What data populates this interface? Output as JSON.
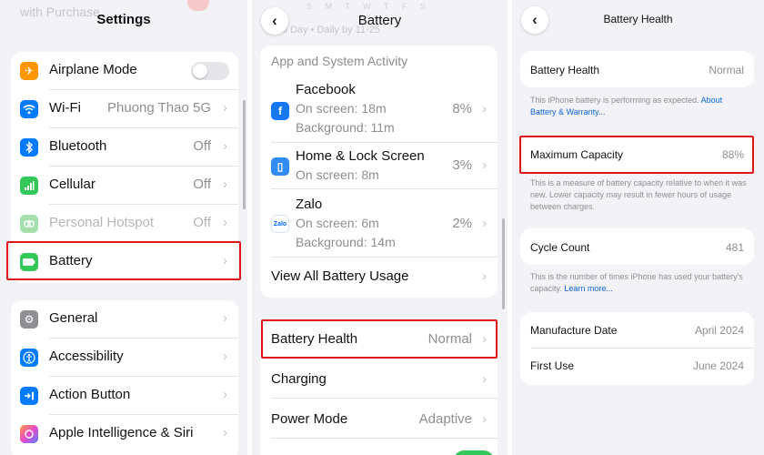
{
  "settings": {
    "ghost_text": "with Purchase",
    "title": "Settings",
    "group1": [
      {
        "label": "Airplane Mode",
        "value": "",
        "icon": "airplane-icon",
        "color": "#ff9500",
        "toggle": true,
        "dim": false
      },
      {
        "label": "Wi-Fi",
        "value": "Phuong Thao 5G",
        "icon": "wifi-icon",
        "color": "#007aff",
        "toggle": false,
        "dim": false
      },
      {
        "label": "Bluetooth",
        "value": "Off",
        "icon": "bluetooth-icon",
        "color": "#007aff",
        "toggle": false,
        "dim": false
      },
      {
        "label": "Cellular",
        "value": "Off",
        "icon": "cellular-icon",
        "color": "#34c759",
        "toggle": false,
        "dim": false
      },
      {
        "label": "Personal Hotspot",
        "value": "Off",
        "icon": "hotspot-icon",
        "color": "#a4e0ae",
        "toggle": false,
        "dim": true
      },
      {
        "label": "Battery",
        "value": "",
        "icon": "battery-icon",
        "color": "#34c759",
        "toggle": false,
        "dim": false
      }
    ],
    "group2": [
      {
        "label": "General",
        "icon": "gear-icon",
        "color": "#8e8e93"
      },
      {
        "label": "Accessibility",
        "icon": "accessibility-icon",
        "color": "#007aff"
      },
      {
        "label": "Action Button",
        "icon": "action-button-icon",
        "color": "#007aff"
      },
      {
        "label": "Apple Intelligence & Siri",
        "icon": "siri-icon",
        "color": "#b44fe0"
      }
    ]
  },
  "battery": {
    "title": "Battery",
    "ghost_days": "S M T W T F S",
    "ghost_text": "ll Day  •  Daily by 11-25",
    "section_title": "App and System Activity",
    "apps": [
      {
        "name": "Facebook",
        "lines": [
          "On screen: 18m",
          "Background: 11m"
        ],
        "pct": "8%",
        "icon": "facebook-icon",
        "glyph": "f",
        "color": "#1877f2"
      },
      {
        "name": "Home & Lock Screen",
        "lines": [
          "On screen: 8m"
        ],
        "pct": "3%",
        "icon": "home-lock-screen-icon",
        "glyph": "▯",
        "color": "#2f8cf5"
      },
      {
        "name": "Zalo",
        "lines": [
          "On screen: 6m",
          "Background: 14m"
        ],
        "pct": "2%",
        "icon": "zalo-icon",
        "glyph": "Zalo",
        "color": "#ffffff"
      }
    ],
    "view_all": "View All Battery Usage",
    "rows": [
      {
        "label": "Battery Health",
        "value": "Normal"
      },
      {
        "label": "Charging",
        "value": ""
      },
      {
        "label": "Power Mode",
        "value": "Adaptive"
      }
    ]
  },
  "health": {
    "title": "Battery Health",
    "health_label": "Battery Health",
    "health_value": "Normal",
    "health_note": "This iPhone battery is performing as expected.",
    "health_link": "About Battery & Warranty...",
    "max_label": "Maximum Capacity",
    "max_value": "88%",
    "max_note": "This is a measure of battery capacity relative to when it was new. Lower capacity may result in fewer hours of usage between charges.",
    "cycle_label": "Cycle Count",
    "cycle_value": "481",
    "cycle_note": "This is the number of times iPhone has used your battery's capacity.",
    "cycle_link": "Learn more...",
    "manufacture_label": "Manufacture Date",
    "manufacture_value": "April 2024",
    "first_use_label": "First Use",
    "first_use_value": "June 2024"
  },
  "colors": {
    "highlight": "#e0151b",
    "link": "#0a66d8",
    "toggle_on": "#34c759"
  }
}
